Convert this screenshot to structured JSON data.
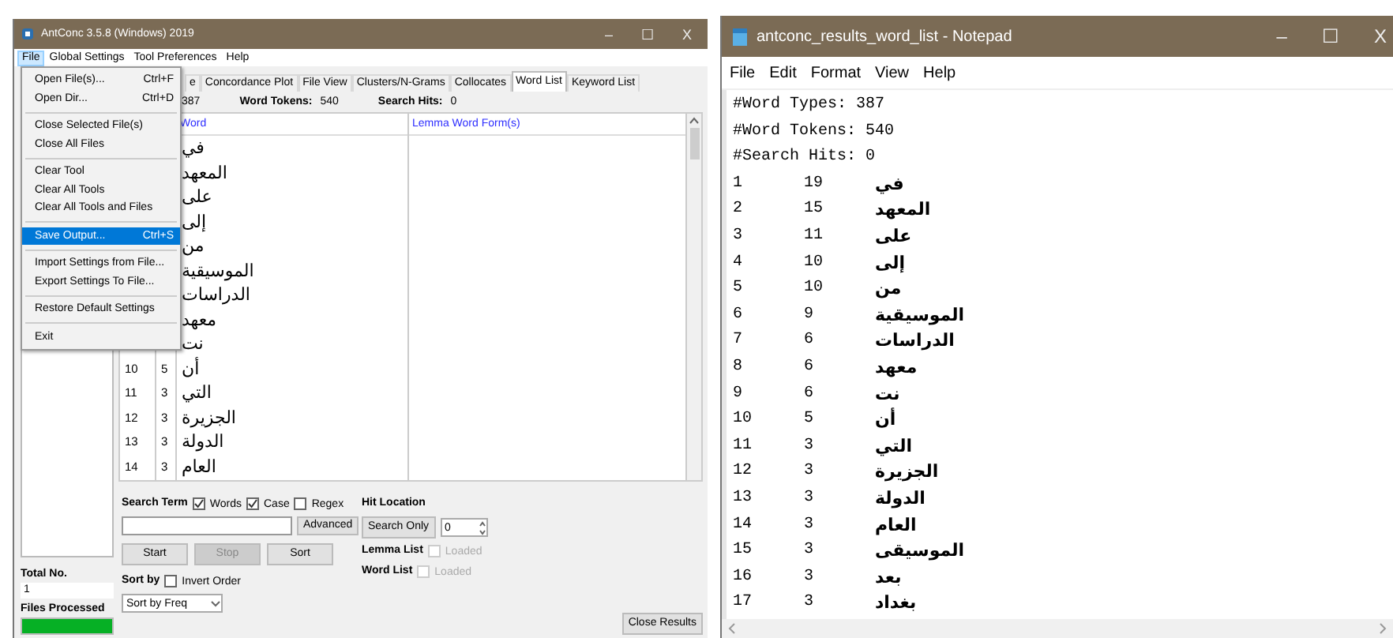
{
  "antconc": {
    "title": "AntConc 3.5.8 (Windows) 2019",
    "window_buttons": [
      "–",
      "☐",
      "X"
    ],
    "menu": [
      {
        "label": "File",
        "selected": true
      },
      {
        "label": "Global Settings",
        "selected": false
      },
      {
        "label": "Tool Preferences",
        "selected": false
      },
      {
        "label": "Help",
        "selected": false
      }
    ],
    "file_menu": [
      {
        "kind": "item",
        "label": "Open File(s)...",
        "shortcut": "Ctrl+F",
        "selected": false
      },
      {
        "kind": "item",
        "label": "Open Dir...",
        "shortcut": "Ctrl+D",
        "selected": false
      },
      {
        "kind": "separator"
      },
      {
        "kind": "item",
        "label": "Close Selected File(s)",
        "selected": false
      },
      {
        "kind": "item",
        "label": "Close All Files",
        "selected": false
      },
      {
        "kind": "separator"
      },
      {
        "kind": "item",
        "label": "Clear Tool",
        "selected": false
      },
      {
        "kind": "item",
        "label": "Clear All Tools",
        "selected": false
      },
      {
        "kind": "item",
        "label": "Clear All Tools and Files",
        "selected": false
      },
      {
        "kind": "separator"
      },
      {
        "kind": "item",
        "label": "Save Output...",
        "shortcut": "Ctrl+S",
        "selected": true
      },
      {
        "kind": "separator"
      },
      {
        "kind": "item",
        "label": "Import Settings from File...",
        "selected": false
      },
      {
        "kind": "item",
        "label": "Export Settings To File...",
        "selected": false
      },
      {
        "kind": "separator"
      },
      {
        "kind": "item",
        "label": "Restore Default Settings",
        "selected": false
      },
      {
        "kind": "separator"
      },
      {
        "kind": "item",
        "label": "Exit",
        "selected": false
      }
    ],
    "tabs": [
      {
        "label": "e",
        "selected": false
      },
      {
        "label": "Concordance Plot",
        "selected": false
      },
      {
        "label": "File View",
        "selected": false
      },
      {
        "label": "Clusters/N-Grams",
        "selected": false
      },
      {
        "label": "Collocates",
        "selected": false
      },
      {
        "label": "Word List",
        "selected": true
      },
      {
        "label": "Keyword List",
        "selected": false
      }
    ],
    "stats": [
      {
        "value": "387"
      },
      {
        "label": "Word Tokens:",
        "value": "540"
      },
      {
        "label": "Search Hits:",
        "value": "0"
      }
    ],
    "columns": [
      "Word",
      "Lemma Word Form(s)"
    ],
    "rows": [
      {
        "word": "في"
      },
      {
        "word": "المعهد"
      },
      {
        "word": "على"
      },
      {
        "word": "إلى"
      },
      {
        "word": "من"
      },
      {
        "word": "الموسيقية"
      },
      {
        "word": "الدراسات"
      },
      {
        "word": "معهد"
      },
      {
        "word": "نت"
      },
      {
        "rank": "10",
        "freq": "5",
        "word": "أن"
      },
      {
        "rank": "11",
        "freq": "3",
        "word": "التي"
      },
      {
        "rank": "12",
        "freq": "3",
        "word": "الجزيرة"
      },
      {
        "rank": "13",
        "freq": "3",
        "word": "الدولة"
      },
      {
        "rank": "14",
        "freq": "3",
        "word": "العام"
      }
    ],
    "search": {
      "label": "Search Term",
      "options": [
        {
          "label": "Words",
          "checked": true
        },
        {
          "label": "Case",
          "checked": true
        },
        {
          "label": "Regex",
          "checked": false
        }
      ],
      "advanced": "Advanced"
    },
    "buttons": [
      {
        "label": "Start",
        "disabled": false
      },
      {
        "label": "Stop",
        "disabled": true
      },
      {
        "label": "Sort",
        "disabled": false
      }
    ],
    "sort": {
      "label": "Sort by",
      "invert": {
        "label": "Invert Order",
        "checked": false
      },
      "value": "Sort by Freq"
    },
    "hit_location": {
      "label": "Hit Location",
      "button": "Search Only",
      "value": "0"
    },
    "lists": [
      {
        "label": "Lemma List",
        "option": "Loaded",
        "checked": false
      },
      {
        "label": "Word List",
        "option": "Loaded",
        "checked": false
      }
    ],
    "close_button": "Close Results",
    "corpus": {
      "total_label": "Total No.",
      "total": "1",
      "processed_label": "Files Processed",
      "level": 1
    }
  },
  "notepad": {
    "title": "antconc_results_word_list - Notepad",
    "window_buttons": [
      "–",
      "☐",
      "X"
    ],
    "menu": [
      "File",
      "Edit",
      "Format",
      "View",
      "Help"
    ],
    "header_lines": [
      "#Word Types: 387",
      "#Word Tokens: 540",
      "#Search Hits: 0"
    ],
    "rows": [
      {
        "rank": "1",
        "freq": "19",
        "word": "في"
      },
      {
        "rank": "2",
        "freq": "15",
        "word": "المعهد"
      },
      {
        "rank": "3",
        "freq": "11",
        "word": "على"
      },
      {
        "rank": "4",
        "freq": "10",
        "word": "إلى"
      },
      {
        "rank": "5",
        "freq": "10",
        "word": "من"
      },
      {
        "rank": "6",
        "freq": "9",
        "word": "الموسيقية"
      },
      {
        "rank": "7",
        "freq": "6",
        "word": "الدراسات"
      },
      {
        "rank": "8",
        "freq": "6",
        "word": "معهد"
      },
      {
        "rank": "9",
        "freq": "6",
        "word": "نت"
      },
      {
        "rank": "10",
        "freq": "5",
        "word": "أن"
      },
      {
        "rank": "11",
        "freq": "3",
        "word": "التي"
      },
      {
        "rank": "12",
        "freq": "3",
        "word": "الجزيرة"
      },
      {
        "rank": "13",
        "freq": "3",
        "word": "الدولة"
      },
      {
        "rank": "14",
        "freq": "3",
        "word": "العام"
      },
      {
        "rank": "15",
        "freq": "3",
        "word": "الموسيقى"
      },
      {
        "rank": "16",
        "freq": "3",
        "word": "بعد"
      },
      {
        "rank": "17",
        "freq": "3",
        "word": "بغداد"
      }
    ]
  }
}
